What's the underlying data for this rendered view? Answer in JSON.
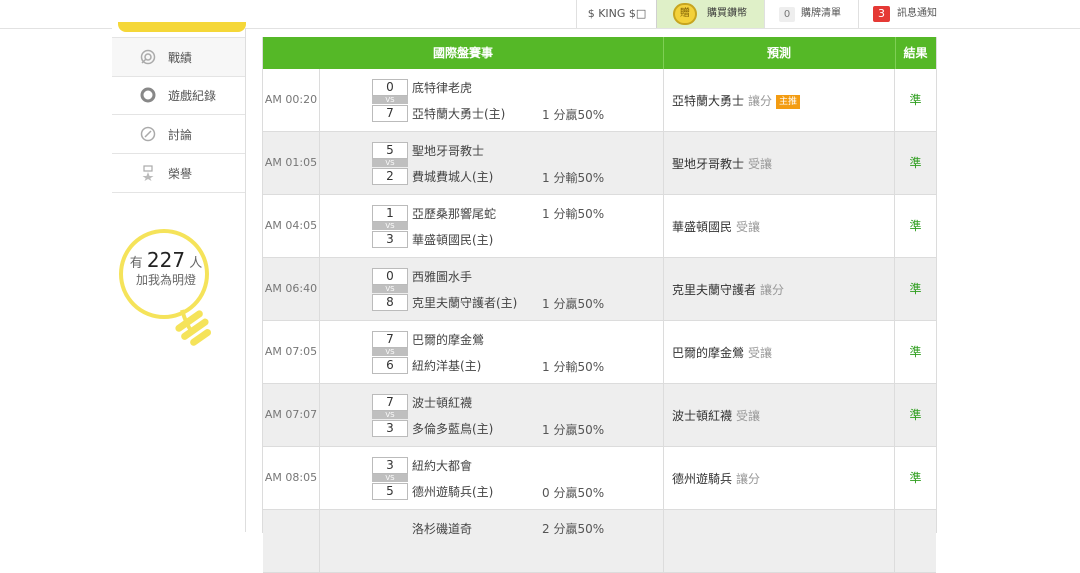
{
  "topbar": {
    "king_label": "$ KING $□",
    "buy_coin_char": "贈",
    "buy_label": "購買鑽幣",
    "list_count": "0",
    "list_label": "購牌清單",
    "msg_count": "3",
    "msg_label": "訊息通知"
  },
  "sidebar": {
    "items": [
      {
        "label": "戰績",
        "icon": "target-icon"
      },
      {
        "label": "遊戲紀錄",
        "icon": "ring-icon"
      },
      {
        "label": "討論",
        "icon": "chat-icon"
      },
      {
        "label": "榮譽",
        "icon": "medal-icon"
      }
    ],
    "bulb": {
      "prefix": "有",
      "count": "227",
      "suffix": "人",
      "line2": "加我為明燈"
    }
  },
  "table": {
    "headers": {
      "match": "國際盤賽事",
      "prediction": "預測",
      "result": "結果"
    },
    "rows": [
      {
        "time": "AM 00:20",
        "score1": "0",
        "team1": "底特律老虎",
        "score2": "7",
        "team2": "亞特蘭大勇士(主)",
        "odds": "1 分贏50%",
        "odds_row": 2,
        "pred_team": "亞特蘭大勇士",
        "pred_type": "讓分",
        "badge": "主推",
        "result": "準"
      },
      {
        "time": "AM 01:05",
        "score1": "5",
        "team1": "聖地牙哥教士",
        "score2": "2",
        "team2": "費城費城人(主)",
        "odds": "1 分輸50%",
        "odds_row": 2,
        "pred_team": "聖地牙哥教士",
        "pred_type": "受讓",
        "badge": "",
        "result": "準"
      },
      {
        "time": "AM 04:05",
        "score1": "1",
        "team1": "亞歷桑那響尾蛇",
        "score2": "3",
        "team2": "華盛頓國民(主)",
        "odds": "1 分輸50%",
        "odds_row": 1,
        "pred_team": "華盛頓國民",
        "pred_type": "受讓",
        "badge": "",
        "result": "準"
      },
      {
        "time": "AM 06:40",
        "score1": "0",
        "team1": "西雅圖水手",
        "score2": "8",
        "team2": "克里夫蘭守護者(主)",
        "odds": "1 分贏50%",
        "odds_row": 2,
        "pred_team": "克里夫蘭守護者",
        "pred_type": "讓分",
        "badge": "",
        "result": "準"
      },
      {
        "time": "AM 07:05",
        "score1": "7",
        "team1": "巴爾的摩金鶯",
        "score2": "6",
        "team2": "紐約洋基(主)",
        "odds": "1 分輸50%",
        "odds_row": 2,
        "pred_team": "巴爾的摩金鶯",
        "pred_type": "受讓",
        "badge": "",
        "result": "準"
      },
      {
        "time": "AM 07:07",
        "score1": "7",
        "team1": "波士頓紅襪",
        "score2": "3",
        "team2": "多倫多藍鳥(主)",
        "odds": "1 分贏50%",
        "odds_row": 2,
        "pred_team": "波士頓紅襪",
        "pred_type": "受讓",
        "badge": "",
        "result": "準"
      },
      {
        "time": "AM 08:05",
        "score1": "3",
        "team1": "紐約大都會",
        "score2": "5",
        "team2": "德州遊騎兵(主)",
        "odds": "0 分贏50%",
        "odds_row": 2,
        "pred_team": "德州遊騎兵",
        "pred_type": "讓分",
        "badge": "",
        "result": "準"
      },
      {
        "time": "",
        "score1": "",
        "team1": "洛杉磯道奇",
        "score2": "",
        "team2": "",
        "odds": "2 分贏50%",
        "odds_row": 1,
        "pred_team": "",
        "pred_type": "",
        "badge": "",
        "result": ""
      }
    ]
  },
  "colors": {
    "header_green": "#55b827",
    "result_green": "#2f9e1f",
    "badge_orange": "#f39c12",
    "bulb_yellow": "#f5e35a",
    "alert_red": "#e53935"
  }
}
